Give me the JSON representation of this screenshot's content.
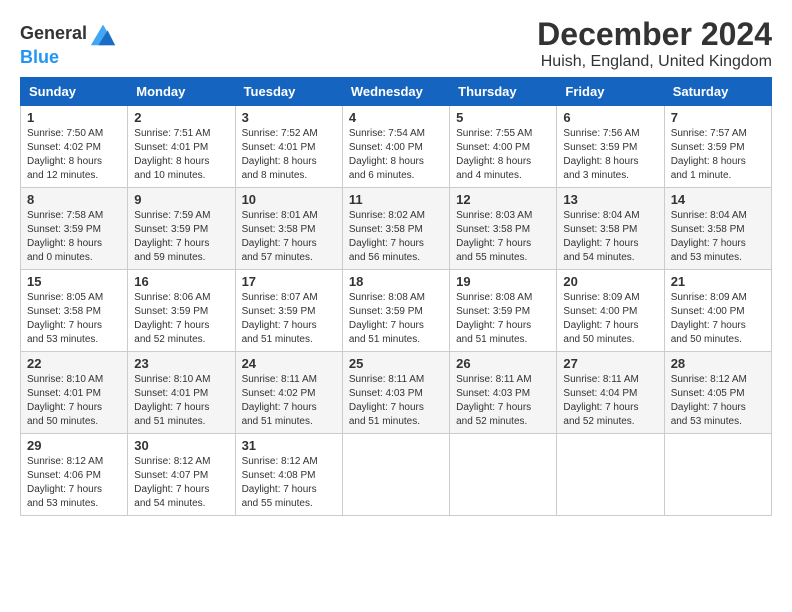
{
  "logo": {
    "line1": "General",
    "line2": "Blue"
  },
  "title": "December 2024",
  "subtitle": "Huish, England, United Kingdom",
  "colors": {
    "header_bg": "#1565C0",
    "header_text": "#ffffff"
  },
  "days_of_week": [
    "Sunday",
    "Monday",
    "Tuesday",
    "Wednesday",
    "Thursday",
    "Friday",
    "Saturday"
  ],
  "weeks": [
    [
      {
        "day": "1",
        "sunrise": "Sunrise: 7:50 AM",
        "sunset": "Sunset: 4:02 PM",
        "daylight": "Daylight: 8 hours and 12 minutes."
      },
      {
        "day": "2",
        "sunrise": "Sunrise: 7:51 AM",
        "sunset": "Sunset: 4:01 PM",
        "daylight": "Daylight: 8 hours and 10 minutes."
      },
      {
        "day": "3",
        "sunrise": "Sunrise: 7:52 AM",
        "sunset": "Sunset: 4:01 PM",
        "daylight": "Daylight: 8 hours and 8 minutes."
      },
      {
        "day": "4",
        "sunrise": "Sunrise: 7:54 AM",
        "sunset": "Sunset: 4:00 PM",
        "daylight": "Daylight: 8 hours and 6 minutes."
      },
      {
        "day": "5",
        "sunrise": "Sunrise: 7:55 AM",
        "sunset": "Sunset: 4:00 PM",
        "daylight": "Daylight: 8 hours and 4 minutes."
      },
      {
        "day": "6",
        "sunrise": "Sunrise: 7:56 AM",
        "sunset": "Sunset: 3:59 PM",
        "daylight": "Daylight: 8 hours and 3 minutes."
      },
      {
        "day": "7",
        "sunrise": "Sunrise: 7:57 AM",
        "sunset": "Sunset: 3:59 PM",
        "daylight": "Daylight: 8 hours and 1 minute."
      }
    ],
    [
      {
        "day": "8",
        "sunrise": "Sunrise: 7:58 AM",
        "sunset": "Sunset: 3:59 PM",
        "daylight": "Daylight: 8 hours and 0 minutes."
      },
      {
        "day": "9",
        "sunrise": "Sunrise: 7:59 AM",
        "sunset": "Sunset: 3:59 PM",
        "daylight": "Daylight: 7 hours and 59 minutes."
      },
      {
        "day": "10",
        "sunrise": "Sunrise: 8:01 AM",
        "sunset": "Sunset: 3:58 PM",
        "daylight": "Daylight: 7 hours and 57 minutes."
      },
      {
        "day": "11",
        "sunrise": "Sunrise: 8:02 AM",
        "sunset": "Sunset: 3:58 PM",
        "daylight": "Daylight: 7 hours and 56 minutes."
      },
      {
        "day": "12",
        "sunrise": "Sunrise: 8:03 AM",
        "sunset": "Sunset: 3:58 PM",
        "daylight": "Daylight: 7 hours and 55 minutes."
      },
      {
        "day": "13",
        "sunrise": "Sunrise: 8:04 AM",
        "sunset": "Sunset: 3:58 PM",
        "daylight": "Daylight: 7 hours and 54 minutes."
      },
      {
        "day": "14",
        "sunrise": "Sunrise: 8:04 AM",
        "sunset": "Sunset: 3:58 PM",
        "daylight": "Daylight: 7 hours and 53 minutes."
      }
    ],
    [
      {
        "day": "15",
        "sunrise": "Sunrise: 8:05 AM",
        "sunset": "Sunset: 3:58 PM",
        "daylight": "Daylight: 7 hours and 53 minutes."
      },
      {
        "day": "16",
        "sunrise": "Sunrise: 8:06 AM",
        "sunset": "Sunset: 3:59 PM",
        "daylight": "Daylight: 7 hours and 52 minutes."
      },
      {
        "day": "17",
        "sunrise": "Sunrise: 8:07 AM",
        "sunset": "Sunset: 3:59 PM",
        "daylight": "Daylight: 7 hours and 51 minutes."
      },
      {
        "day": "18",
        "sunrise": "Sunrise: 8:08 AM",
        "sunset": "Sunset: 3:59 PM",
        "daylight": "Daylight: 7 hours and 51 minutes."
      },
      {
        "day": "19",
        "sunrise": "Sunrise: 8:08 AM",
        "sunset": "Sunset: 3:59 PM",
        "daylight": "Daylight: 7 hours and 51 minutes."
      },
      {
        "day": "20",
        "sunrise": "Sunrise: 8:09 AM",
        "sunset": "Sunset: 4:00 PM",
        "daylight": "Daylight: 7 hours and 50 minutes."
      },
      {
        "day": "21",
        "sunrise": "Sunrise: 8:09 AM",
        "sunset": "Sunset: 4:00 PM",
        "daylight": "Daylight: 7 hours and 50 minutes."
      }
    ],
    [
      {
        "day": "22",
        "sunrise": "Sunrise: 8:10 AM",
        "sunset": "Sunset: 4:01 PM",
        "daylight": "Daylight: 7 hours and 50 minutes."
      },
      {
        "day": "23",
        "sunrise": "Sunrise: 8:10 AM",
        "sunset": "Sunset: 4:01 PM",
        "daylight": "Daylight: 7 hours and 51 minutes."
      },
      {
        "day": "24",
        "sunrise": "Sunrise: 8:11 AM",
        "sunset": "Sunset: 4:02 PM",
        "daylight": "Daylight: 7 hours and 51 minutes."
      },
      {
        "day": "25",
        "sunrise": "Sunrise: 8:11 AM",
        "sunset": "Sunset: 4:03 PM",
        "daylight": "Daylight: 7 hours and 51 minutes."
      },
      {
        "day": "26",
        "sunrise": "Sunrise: 8:11 AM",
        "sunset": "Sunset: 4:03 PM",
        "daylight": "Daylight: 7 hours and 52 minutes."
      },
      {
        "day": "27",
        "sunrise": "Sunrise: 8:11 AM",
        "sunset": "Sunset: 4:04 PM",
        "daylight": "Daylight: 7 hours and 52 minutes."
      },
      {
        "day": "28",
        "sunrise": "Sunrise: 8:12 AM",
        "sunset": "Sunset: 4:05 PM",
        "daylight": "Daylight: 7 hours and 53 minutes."
      }
    ],
    [
      {
        "day": "29",
        "sunrise": "Sunrise: 8:12 AM",
        "sunset": "Sunset: 4:06 PM",
        "daylight": "Daylight: 7 hours and 53 minutes."
      },
      {
        "day": "30",
        "sunrise": "Sunrise: 8:12 AM",
        "sunset": "Sunset: 4:07 PM",
        "daylight": "Daylight: 7 hours and 54 minutes."
      },
      {
        "day": "31",
        "sunrise": "Sunrise: 8:12 AM",
        "sunset": "Sunset: 4:08 PM",
        "daylight": "Daylight: 7 hours and 55 minutes."
      },
      null,
      null,
      null,
      null
    ]
  ]
}
